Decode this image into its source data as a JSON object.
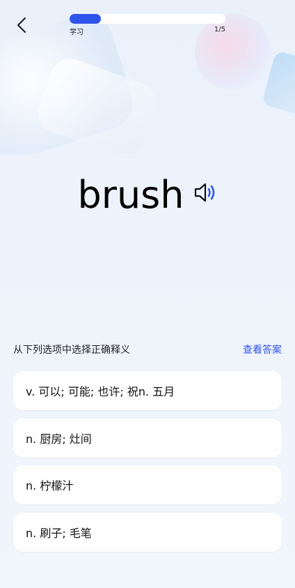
{
  "header": {
    "back_icon": "chevron-left-icon",
    "progress": {
      "label": "学习",
      "count": "1/5",
      "fraction": 0.2
    }
  },
  "word": {
    "text": "brush",
    "speaker_icon": "speaker-icon"
  },
  "quiz": {
    "prompt": "从下列选项中选择正确释义",
    "show_answer": "查看答案",
    "options": [
      {
        "text": "v. 可以; 可能; 也许; 祝n. 五月"
      },
      {
        "text": "n. 厨房; 灶间"
      },
      {
        "text": "n. 柠檬汁"
      },
      {
        "text": "n. 刷子; 毛笔"
      }
    ]
  },
  "colors": {
    "accent": "#2f54eb",
    "background": "#eef3fb"
  }
}
